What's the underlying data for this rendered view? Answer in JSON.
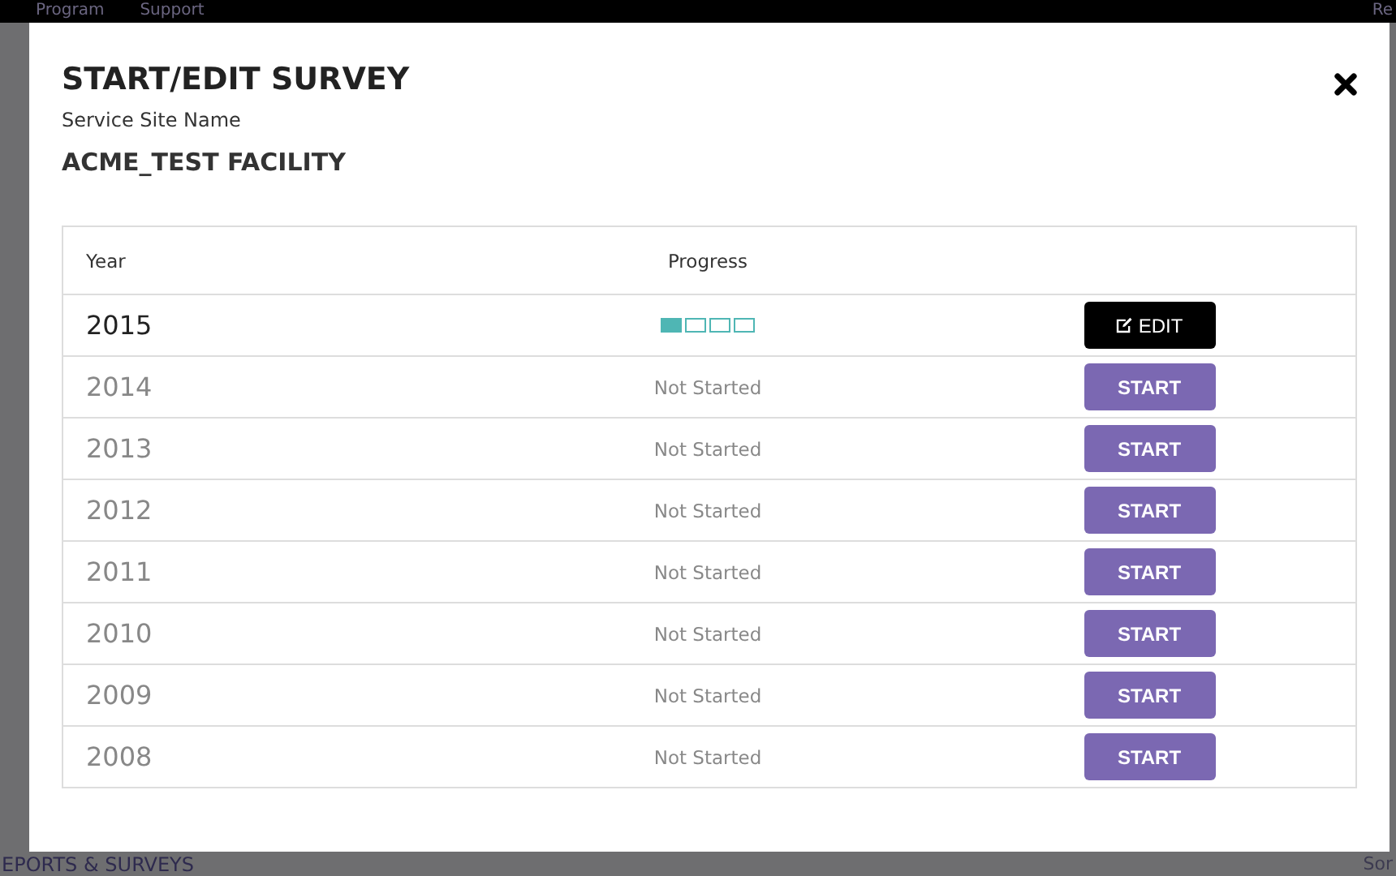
{
  "background": {
    "nav_items": [
      "Program",
      "Support"
    ],
    "nav_right": "Re",
    "section_heading": "EPORTS & SURVEYS",
    "corner_text": "Sor"
  },
  "dialog": {
    "title": "START/EDIT SURVEY",
    "site_label": "Service Site Name",
    "site_name": "ACME_TEST FACILITY",
    "table": {
      "columns": [
        "Year",
        "Progress"
      ],
      "rows": [
        {
          "year": "2015",
          "kind": "in_progress",
          "segments": [
            {
              "filled": true
            },
            {
              "filled": false
            },
            {
              "filled": false
            },
            {
              "filled": false
            }
          ],
          "action": {
            "kind": "edit",
            "label": "EDIT"
          }
        },
        {
          "year": "2014",
          "kind": "not_started",
          "status": "Not Started",
          "action": {
            "kind": "start",
            "label": "START"
          }
        },
        {
          "year": "2013",
          "kind": "not_started",
          "status": "Not Started",
          "action": {
            "kind": "start",
            "label": "START"
          }
        },
        {
          "year": "2012",
          "kind": "not_started",
          "status": "Not Started",
          "action": {
            "kind": "start",
            "label": "START"
          }
        },
        {
          "year": "2011",
          "kind": "not_started",
          "status": "Not Started",
          "action": {
            "kind": "start",
            "label": "START"
          }
        },
        {
          "year": "2010",
          "kind": "not_started",
          "status": "Not Started",
          "action": {
            "kind": "start",
            "label": "START"
          }
        },
        {
          "year": "2009",
          "kind": "not_started",
          "status": "Not Started",
          "action": {
            "kind": "start",
            "label": "START"
          }
        },
        {
          "year": "2008",
          "kind": "not_started",
          "status": "Not Started",
          "action": {
            "kind": "start",
            "label": "START"
          }
        }
      ]
    }
  }
}
